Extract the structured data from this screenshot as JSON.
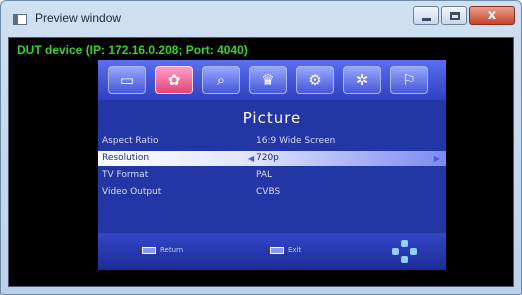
{
  "window": {
    "title": "Preview window"
  },
  "window_controls": {
    "close_glyph": "x"
  },
  "device": {
    "label": "DUT device (IP: 172.16.0.208; Port: 4040)"
  },
  "tv_menu": {
    "top_icons": [
      {
        "name": "tv-icon",
        "glyph": "▭",
        "active": false
      },
      {
        "name": "picture-reel-icon",
        "glyph": "✿",
        "active": true
      },
      {
        "name": "search-icon",
        "glyph": "⌕",
        "active": false
      },
      {
        "name": "crown-icon",
        "glyph": "♛",
        "active": false
      },
      {
        "name": "gear-icon",
        "glyph": "⚙",
        "active": false
      },
      {
        "name": "settings-gear-icon",
        "glyph": "✲",
        "active": false
      },
      {
        "name": "info-icon",
        "glyph": "⚐",
        "active": false
      }
    ],
    "title": "Picture",
    "rows": [
      {
        "label": "Aspect Ratio",
        "value": "16:9 Wide Screen",
        "selected": false
      },
      {
        "label": "Resolution",
        "value": "720p",
        "selected": true
      },
      {
        "label": "TV Format",
        "value": "PAL",
        "selected": false
      },
      {
        "label": "Video Output",
        "value": "CVBS",
        "selected": false
      }
    ],
    "bottom_hints": {
      "left_label": "Return",
      "mid_label": "Exit"
    },
    "colors": {
      "panel_blue": "#2336a6",
      "selected_text": "#1c2a8a",
      "dut_green": "#39d12b"
    }
  }
}
